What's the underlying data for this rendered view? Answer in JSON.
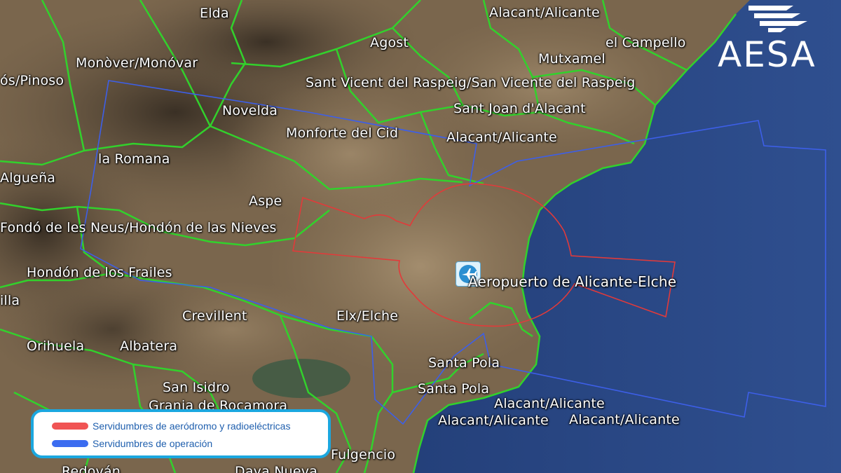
{
  "map": {
    "kind": "satellite map",
    "water_color": "#2c4b86",
    "land_color": "#6b5a45",
    "municipal_boundary_color": "#32d12c",
    "places": [
      "Elda",
      "Alacant/Alicante",
      "Agost",
      "el Campello",
      "Mutxamel",
      "Monòver/Monóvar",
      "ós/Pinoso",
      "Sant Vicent del Raspeig/San Vicente del Raspeig",
      "Novelda",
      "Sant Joan d'Alacant",
      "Monforte del Cid",
      "Alacant/Alicante",
      "la Romana",
      "Algueña",
      "Aspe",
      "Fondó de les Neus/Hondón de las Nieves",
      "Hondón de los Frailes",
      "illa",
      "Crevillent",
      "Elx/Elche",
      "Orihuela",
      "Albatera",
      "Santa Pola",
      "Santa Pola",
      "San Isidro",
      "Granja de Rocamora",
      "Alacant/Alicante",
      "Alacant/Alicante",
      "Alacant/Alicante",
      "Fulgencio",
      "Redován",
      "Daya Nueva"
    ],
    "airport": {
      "label": "Aeropuerto de Alicante-Elche",
      "icon": "airport-icon"
    }
  },
  "logo": {
    "text": "AESA",
    "icon": "aesa-wing-logo-icon",
    "color": "#ffffff"
  },
  "legend": {
    "items": [
      {
        "label": "Servidumbres de aeródromo y radioeléctricas",
        "color": "#f05454"
      },
      {
        "label": "Servidumbres de operación",
        "color": "#3b6cf0"
      }
    ]
  }
}
